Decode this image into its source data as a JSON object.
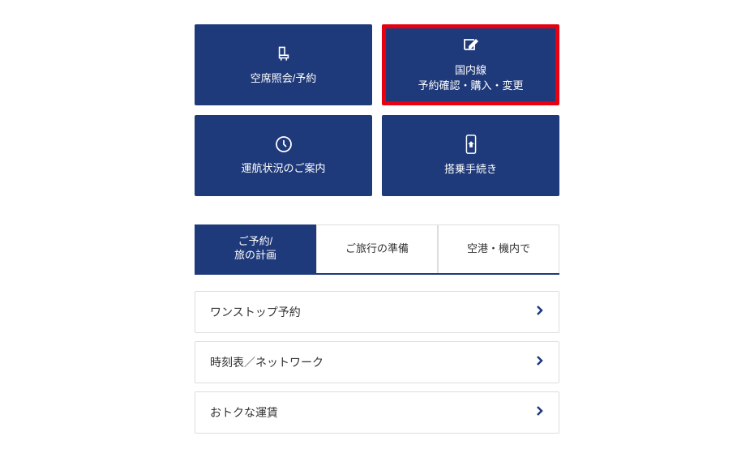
{
  "tiles": [
    {
      "label": "空席照会/予約",
      "icon": "seat-icon",
      "highlighted": false
    },
    {
      "label_line1": "国内線",
      "label_line2": "予約確認・購入・変更",
      "icon": "edit-icon",
      "highlighted": true
    },
    {
      "label": "運航状況のご案内",
      "icon": "clock-icon",
      "highlighted": false
    },
    {
      "label": "搭乗手続き",
      "icon": "boarding-icon",
      "highlighted": false
    }
  ],
  "tabs": [
    {
      "label_line1": "ご予約/",
      "label_line2": "旅の計画",
      "active": true
    },
    {
      "label": "ご旅行の準備",
      "active": false
    },
    {
      "label": "空港・機内で",
      "active": false
    }
  ],
  "list_items": [
    {
      "label": "ワンストップ予約"
    },
    {
      "label": "時刻表／ネットワーク"
    },
    {
      "label": "おトクな運賃"
    }
  ],
  "colors": {
    "primary": "#1f3a7a",
    "highlight": "#e60012"
  }
}
